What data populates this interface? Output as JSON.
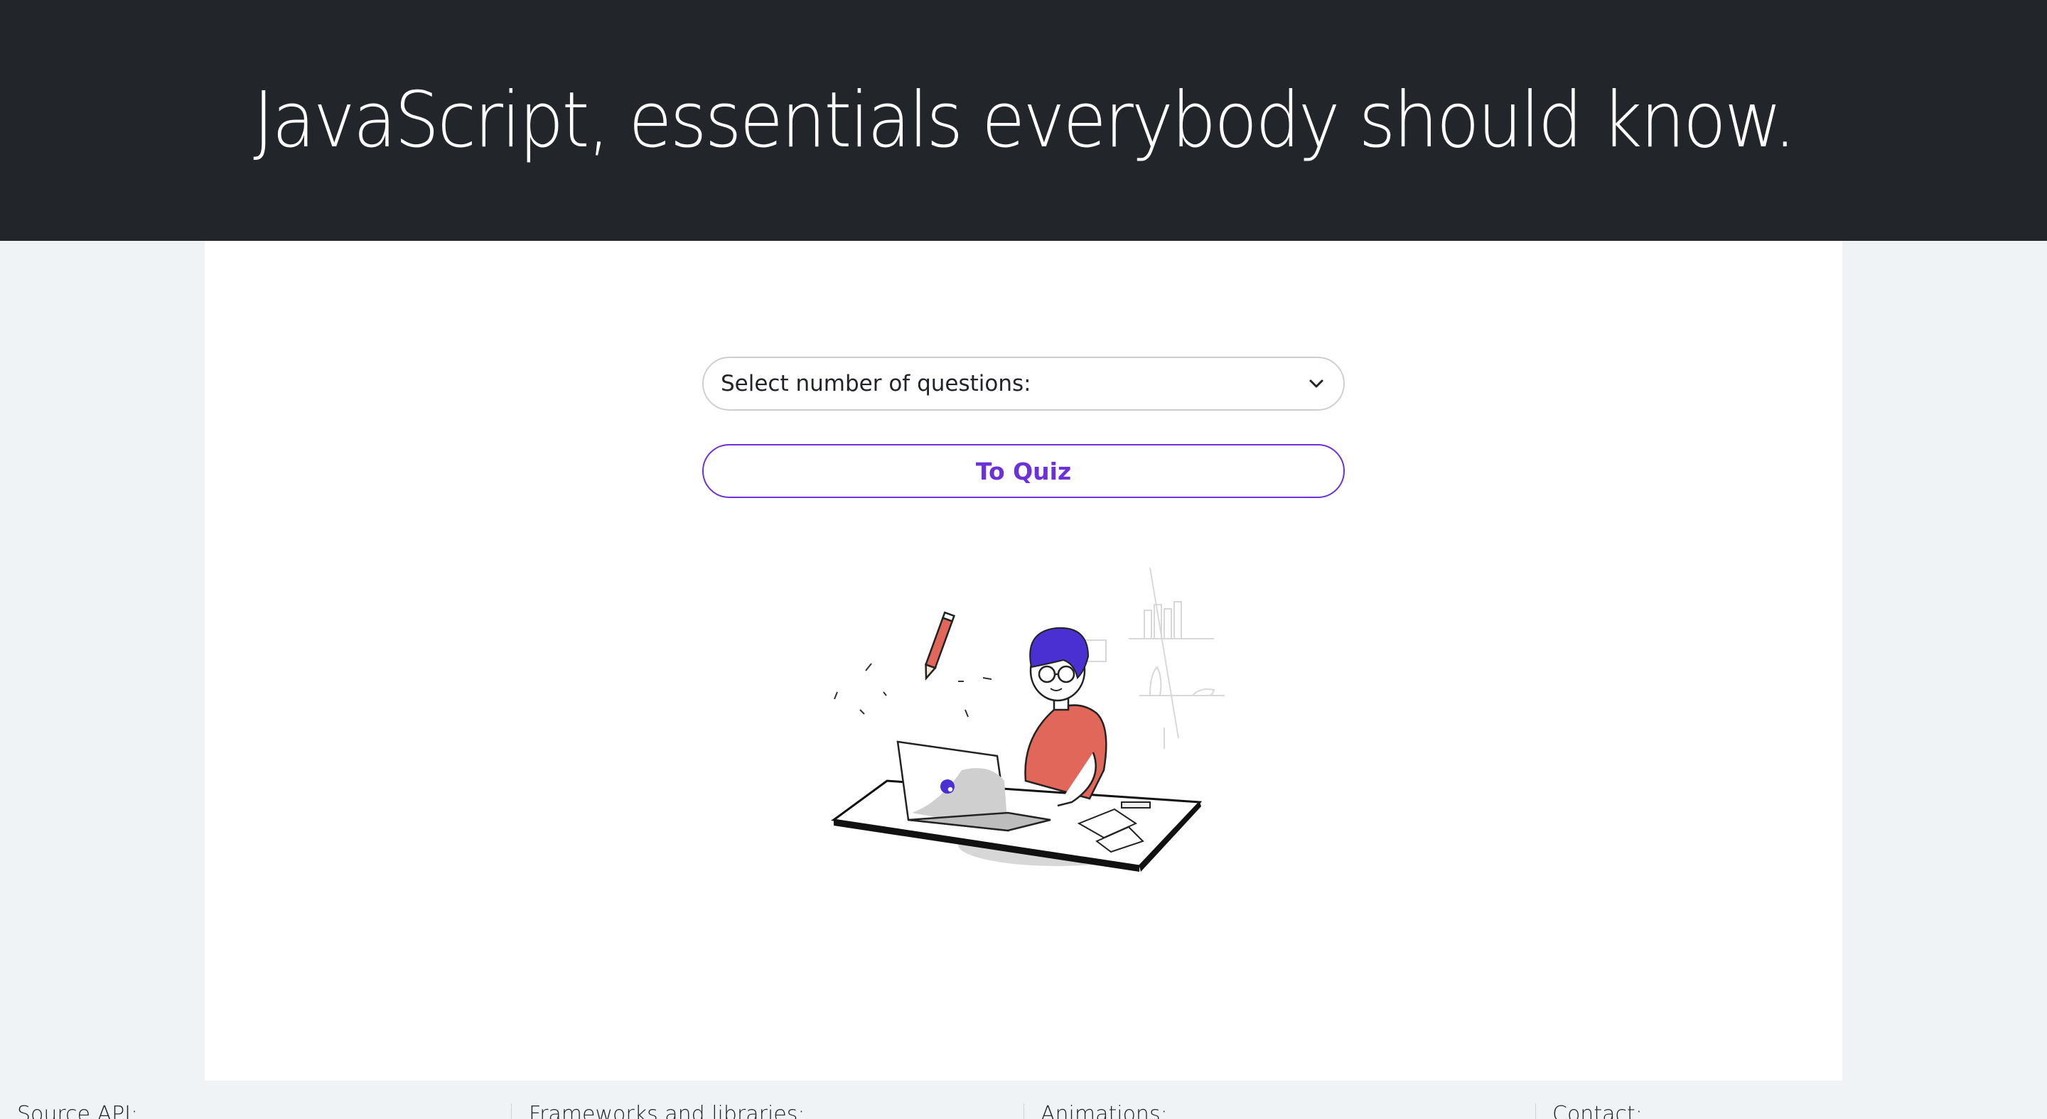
{
  "header": {
    "title": "JavaScript, essentials everybody should know."
  },
  "quiz_form": {
    "select_value": "Select number of questions:",
    "select_icon": "chevron-down-icon",
    "submit_label": "To Quiz"
  },
  "illustration": {
    "subject": "person-at-laptop-illustration"
  },
  "footer": {
    "columns": [
      "Source API:",
      "Frameworks and libraries:",
      "Animations:",
      "Contact:"
    ]
  },
  "colors": {
    "header_bg": "#22262b",
    "accent": "#6b32d9",
    "page_bg": "#f0f3f6",
    "card_bg": "#ffffff",
    "hair": "#4a2fd1",
    "shirt": "#e0675a"
  }
}
